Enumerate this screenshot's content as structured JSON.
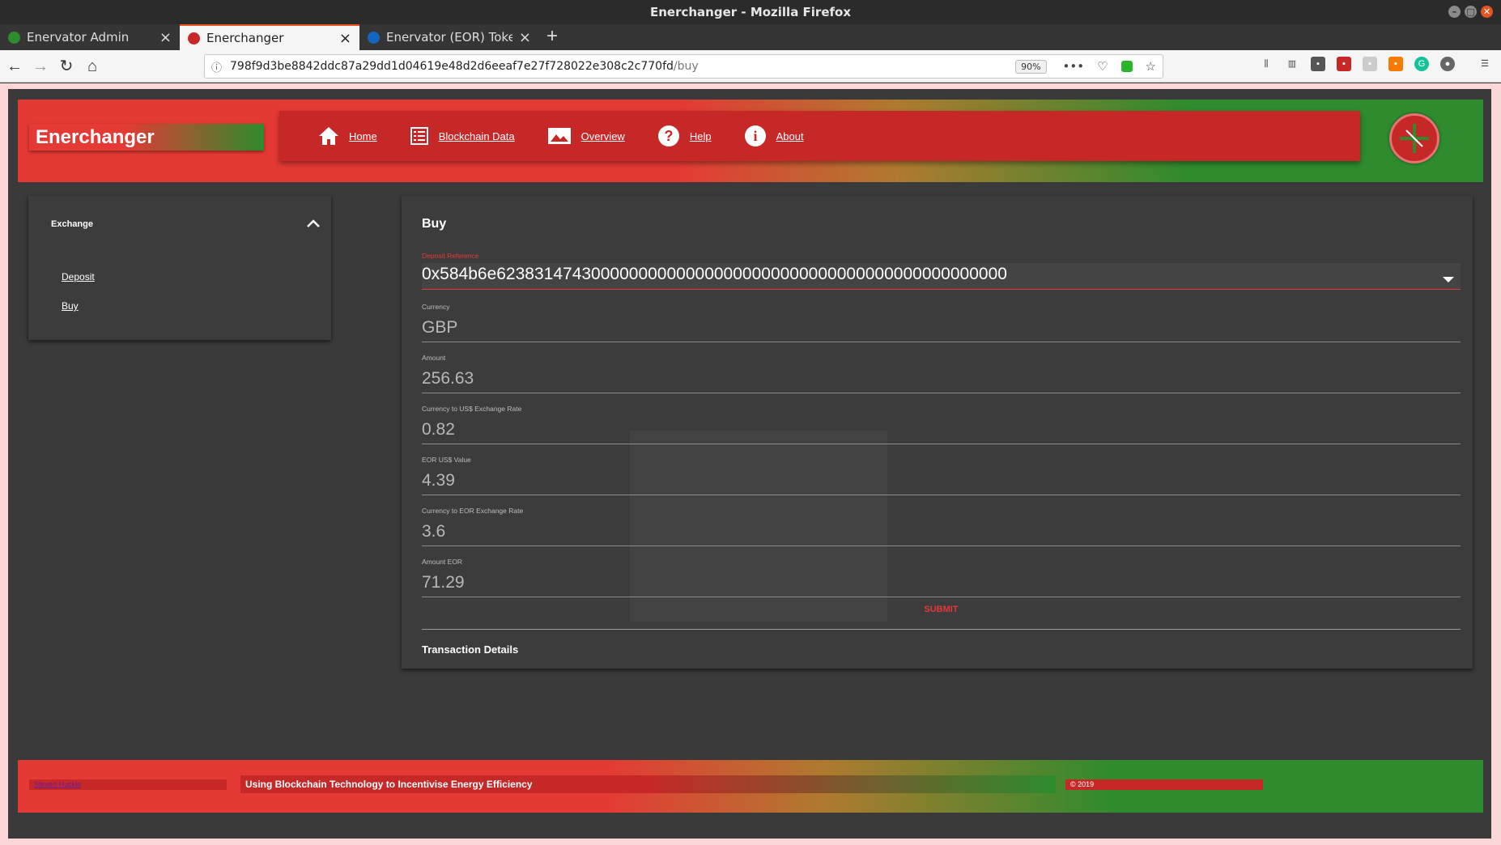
{
  "browser": {
    "window_title": "Enerchanger - Mozilla Firefox",
    "tabs": [
      {
        "label": "Enervator Admin",
        "favicon_color": "#2e8b2e"
      },
      {
        "label": "Enerchanger",
        "favicon_color": "#c62828"
      },
      {
        "label": "Enervator (EOR) Token Tr",
        "favicon_color": "#1565c0"
      }
    ],
    "url": "798f9d3be8842ddc87a29dd1d04619e48d2d6eeaf7e27f728022e308c2c770fd",
    "url_path": "/buy",
    "zoom": "90%"
  },
  "app": {
    "brand": "Enerchanger",
    "menu": [
      {
        "label": "Home",
        "icon": "home-icon"
      },
      {
        "label": "Blockchain Data",
        "icon": "list-icon"
      },
      {
        "label": "Overview",
        "icon": "image-icon"
      },
      {
        "label": "Help",
        "icon": "help-icon"
      },
      {
        "label": "About",
        "icon": "info-icon"
      }
    ]
  },
  "sidebar": {
    "title": "Exchange",
    "items": [
      "Deposit",
      "Buy"
    ]
  },
  "form": {
    "title": "Buy",
    "deposit_reference_label": "Deposit Reference",
    "deposit_reference": "0x584b6e623831474300000000000000000000000000000000000000000000",
    "currency_label": "Currency",
    "currency": "GBP",
    "amount_label": "Amount",
    "amount": "256.63",
    "usd_rate_label": "Currency to US$ Exchange Rate",
    "usd_rate": "0.82",
    "eor_usd_label": "EOR US$ Value",
    "eor_usd": "4.39",
    "eor_rate_label": "Currency to EOR Exchange Rate",
    "eor_rate": "3.6",
    "amount_eor_label": "Amount EOR",
    "amount_eor": "71.29",
    "submit_label": "SUBMIT",
    "transaction_details_title": "Transaction Details"
  },
  "footer": {
    "author": "Steven Huckle",
    "tagline": "Using Blockchain Technology to Incentivise Energy Efficiency",
    "copyright": "© 2019"
  },
  "colors": {
    "brand_red": "#e53935",
    "brand_green": "#2e8b2e",
    "dark_bg": "#3a3a3a"
  }
}
